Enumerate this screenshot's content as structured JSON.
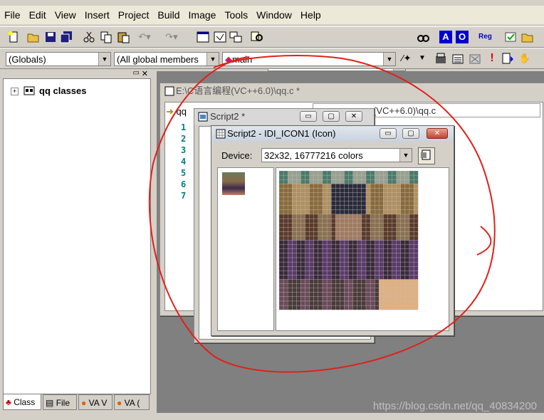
{
  "menu": [
    "File",
    "Edit",
    "View",
    "Insert",
    "Project",
    "Build",
    "Image",
    "Tools",
    "Window",
    "Help"
  ],
  "toolbar1": {
    "icons": [
      "new-file-icon",
      "open-icon",
      "save-icon",
      "save-all-icon",
      "cut-icon",
      "copy-icon",
      "paste-icon",
      "undo-icon",
      "redo-icon",
      "workspace-icon",
      "output-icon",
      "window-list-icon",
      "find-in-files-icon",
      "find-icon",
      "bold-a-icon",
      "outline-a-icon",
      "reg-icon"
    ],
    "find_combo_value": "",
    "reg_label": "Reg"
  },
  "toolbar2": {
    "globals_combo": "(Globals)",
    "members_combo": "(All global members",
    "function_combo": "main"
  },
  "classview": {
    "root_label": "qq classes",
    "expand_glyph": "+"
  },
  "left_tabs": [
    "Class",
    "File",
    "VA V",
    "VA ("
  ],
  "editor_window": {
    "title": "E:\\C语言编程(VC++6.0)\\qq.c *",
    "tab_label": "qq",
    "path_fragment": "(VC++6.0)\\qq.c",
    "line_numbers": [
      "1",
      "2",
      "3",
      "4",
      "5",
      "6",
      "7"
    ]
  },
  "script_window": {
    "title": "Script2 *"
  },
  "icon_editor": {
    "title": "Script2 - IDI_ICON1 (Icon)",
    "device_label": "Device:",
    "device_value": "32x32, 16777216 colors"
  },
  "watermark": "https://blog.csdn.net/qq_40834200",
  "colors": {
    "annotation_circle": "#e0201a",
    "accent_blue": "#0000cc"
  }
}
